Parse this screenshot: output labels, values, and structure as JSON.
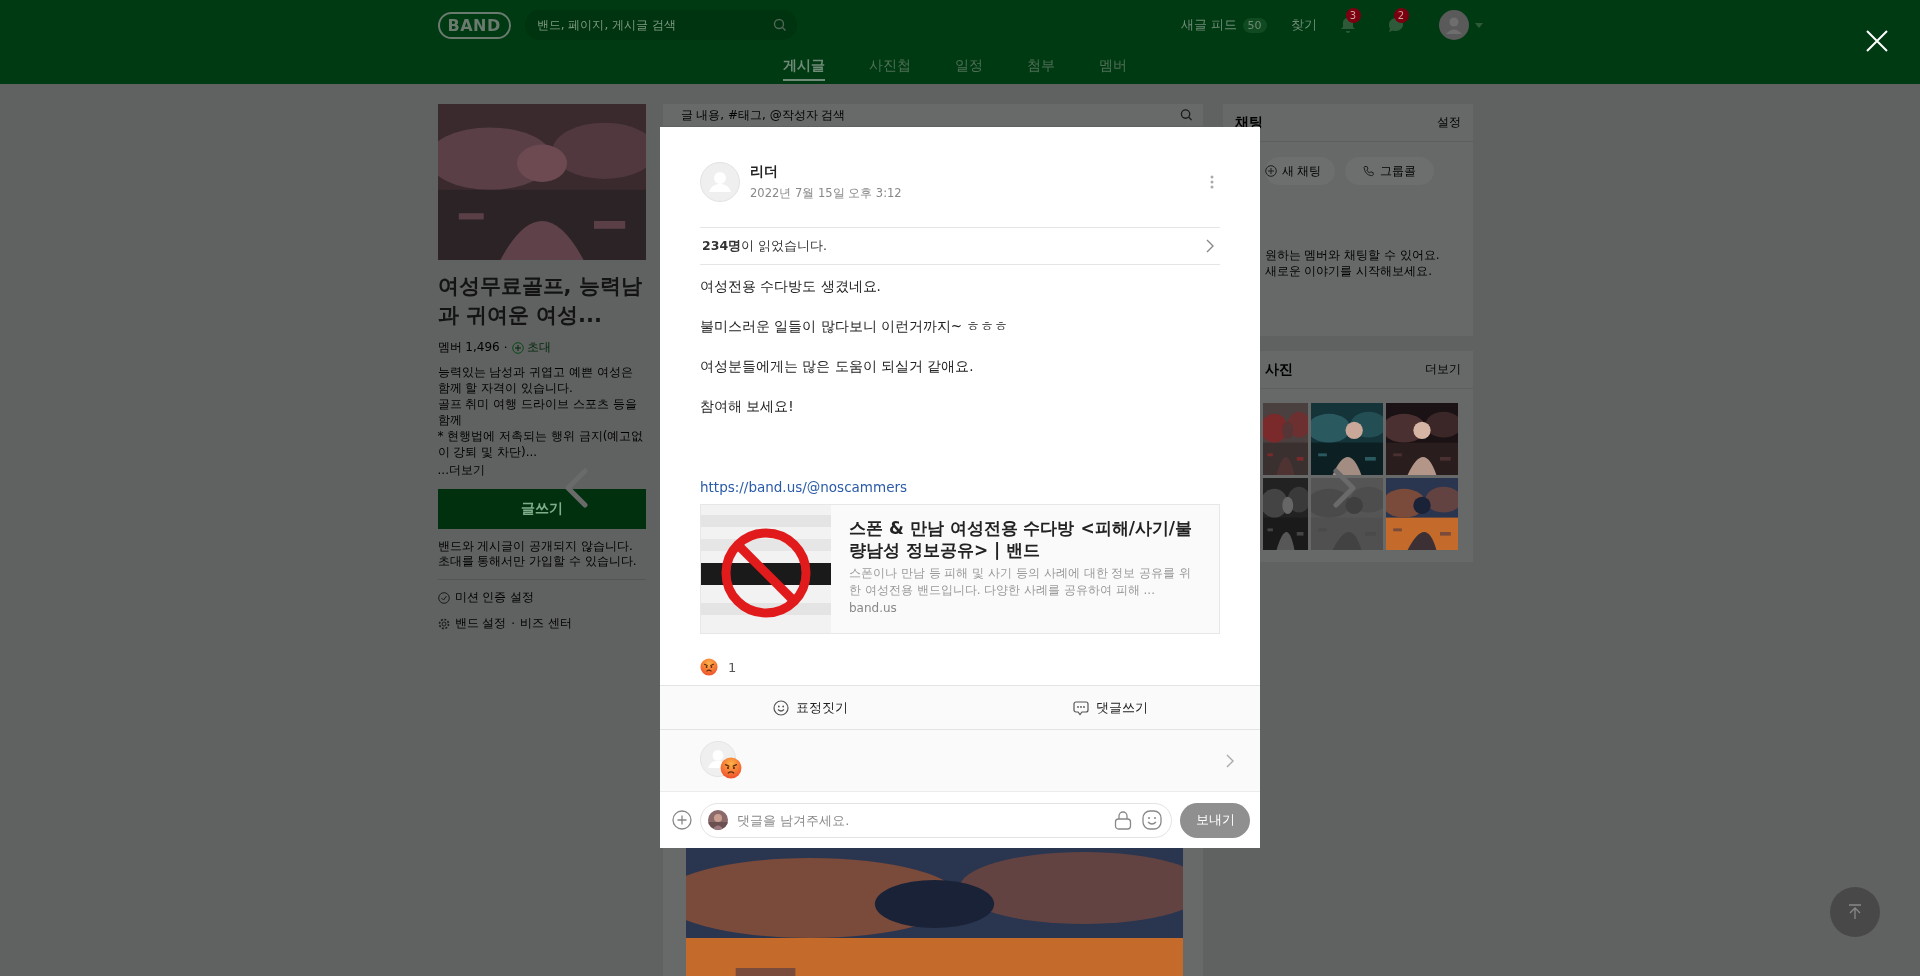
{
  "header": {
    "logo": "BAND",
    "search": {
      "placeholder": "밴드, 페이지, 게시글 검색"
    },
    "new_feed": {
      "label": "새글 피드",
      "count": "50"
    },
    "find": "찾기",
    "notifications": [
      {
        "kind": "bell",
        "count": "3"
      },
      {
        "kind": "chat",
        "count": "2"
      }
    ]
  },
  "nav_tabs": [
    {
      "label": "게시글",
      "selected": true
    },
    {
      "label": "사진첩",
      "selected": false
    },
    {
      "label": "일정",
      "selected": false
    },
    {
      "label": "첨부",
      "selected": false
    },
    {
      "label": "멤버",
      "selected": false
    }
  ],
  "band": {
    "cover": {
      "kind": "picture"
    },
    "title": "여성무료골프, 능력남과 귀여운 여성...",
    "members": "멤버 1,496",
    "member_separator": "·",
    "invite": "초대",
    "description": [
      "능력있는 남성과 귀엽고 예쁜 여성은 함께 할 자격이 있습니다.",
      "골프 취미 여행 드라이브 스포츠 등을 함께",
      "* 현행법에 저촉되는 행위 금지(예고없이 강퇴 및 차단)..."
    ],
    "more": "...더보기",
    "write_button": "글쓰기",
    "notice": "밴드와 게시글이 공개되지 않습니다. 초대를 통해서만 가입할 수 있습니다.",
    "links": [
      {
        "kind": "mission",
        "label": "미션 인증 설정"
      },
      {
        "kind": "settings",
        "label": "밴드 설정"
      },
      {
        "kind": "separator",
        "label": "·"
      },
      {
        "kind": "plain",
        "label": "비즈 센터"
      }
    ]
  },
  "feed": {
    "search": {
      "placeholder": "글 내용, #태그, @작성자 검색"
    },
    "ad": {
      "kind": "picture"
    }
  },
  "chat": {
    "title": "채팅",
    "settings": "설정",
    "buttons": [
      {
        "kind": "new",
        "label": "새 채팅"
      },
      {
        "kind": "call",
        "label": "그룹콜"
      }
    ],
    "hint": [
      "원하는 멤버와 채팅할 수 있어요.",
      "새로운 이야기를 시작해보세요."
    ]
  },
  "photos": {
    "title": "사진",
    "more": "더보기",
    "items": [
      {
        "kind": "picture"
      },
      {
        "kind": "picture"
      },
      {
        "kind": "picture"
      },
      {
        "kind": "picture"
      },
      {
        "kind": "picture"
      },
      {
        "kind": "picture"
      }
    ]
  },
  "post": {
    "author": "리더",
    "date": "2022년 7월 15일 오후 3:12",
    "read": "**234명**이 읽었습니다.",
    "body": [
      "여성전용 수다방도 생겼네요.",
      "불미스러운 일들이 많다보니 이런거까지~ ㅎㅎㅎ",
      "여성분들에게는 많은 도움이 되실거 같애요.",
      "참여해 보세요!"
    ],
    "link": "https://band.us/@noscammers",
    "preview": {
      "title": "스폰 & 만남 여성전용 수다방 <피해/사기/불량남성 정보공유> | 밴드",
      "description": "스폰이나 만남 등 피해 및 사기 등의 사례에 대한 정보 공유를 위한 여성전용 밴드입니다. 다양한 사례를 공유하여 피해 ...",
      "domain": "band.us"
    },
    "reaction_count": "1",
    "actions": [
      {
        "kind": "emotion",
        "label": "표정짓기"
      },
      {
        "kind": "comment",
        "label": "댓글쓰기"
      }
    ],
    "comment_input": {
      "placeholder": "댓글을 남겨주세요."
    },
    "send": {
      "label": "보내기",
      "disabled": true
    }
  }
}
